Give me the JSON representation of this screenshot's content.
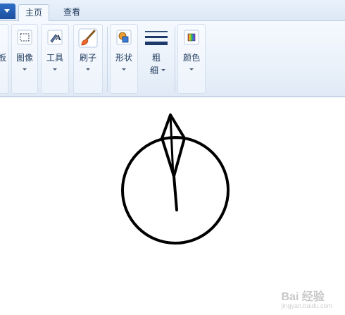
{
  "tabs": {
    "active": "主页",
    "other": "查看"
  },
  "ribbon": {
    "clipboard_partial": "板",
    "image_label": "图像",
    "tools_label": "工具",
    "brushes_label": "刷子",
    "shapes_label": "形状",
    "size_label_line1": "粗",
    "size_label_line2": "细",
    "colors_label": "颜色"
  },
  "icons": {
    "file_menu": "dropdown-caret-icon",
    "image": "select-rectangle-icon",
    "tools": "pencil-tools-icon",
    "brushes": "brush-icon",
    "shapes": "shapes-icon",
    "size": "line-size-icon",
    "colors": "color-palette-icon"
  },
  "colors": {
    "ribbon_bg": "#eaf1fa",
    "tab_text": "#1e395b",
    "drawing_stroke": "#000000",
    "brush_accent": "#e8672a"
  },
  "watermark": {
    "brand": "Bai 经验",
    "url": "jingyan.baidu.com"
  }
}
